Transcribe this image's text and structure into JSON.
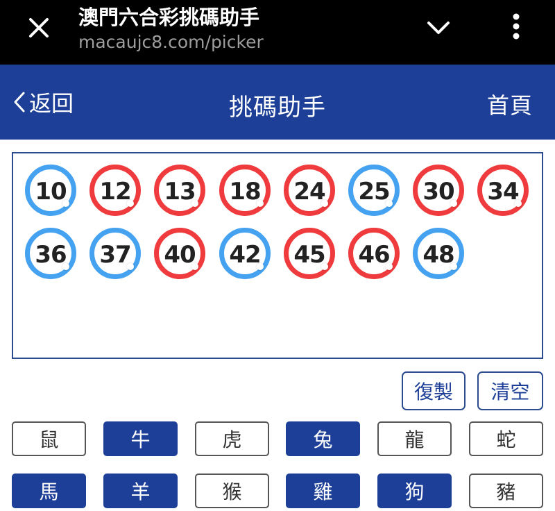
{
  "browser": {
    "title": "澳門六合彩挑碼助手",
    "url": "macaujc8.com/picker"
  },
  "header": {
    "back_label": "返回",
    "title": "挑碼助手",
    "home_label": "首頁",
    "color": "#1d3f97"
  },
  "picked_numbers": [
    {
      "num": "10",
      "color": "blue"
    },
    {
      "num": "12",
      "color": "red"
    },
    {
      "num": "13",
      "color": "red"
    },
    {
      "num": "18",
      "color": "red"
    },
    {
      "num": "24",
      "color": "red"
    },
    {
      "num": "25",
      "color": "blue"
    },
    {
      "num": "30",
      "color": "red"
    },
    {
      "num": "34",
      "color": "red"
    },
    {
      "num": "36",
      "color": "blue"
    },
    {
      "num": "37",
      "color": "blue"
    },
    {
      "num": "40",
      "color": "red"
    },
    {
      "num": "42",
      "color": "blue"
    },
    {
      "num": "45",
      "color": "red"
    },
    {
      "num": "46",
      "color": "red"
    },
    {
      "num": "48",
      "color": "blue"
    }
  ],
  "ball_colors": {
    "red": "#ef3b3d",
    "blue": "#45a2f0"
  },
  "actions": {
    "copy_label": "復製",
    "clear_label": "清空"
  },
  "zodiacs": [
    {
      "label": "鼠",
      "selected": false
    },
    {
      "label": "牛",
      "selected": true
    },
    {
      "label": "虎",
      "selected": false
    },
    {
      "label": "兔",
      "selected": true
    },
    {
      "label": "龍",
      "selected": false
    },
    {
      "label": "蛇",
      "selected": false
    },
    {
      "label": "馬",
      "selected": true
    },
    {
      "label": "羊",
      "selected": true
    },
    {
      "label": "猴",
      "selected": false
    },
    {
      "label": "雞",
      "selected": true
    },
    {
      "label": "狗",
      "selected": true
    },
    {
      "label": "豬",
      "selected": false
    }
  ]
}
